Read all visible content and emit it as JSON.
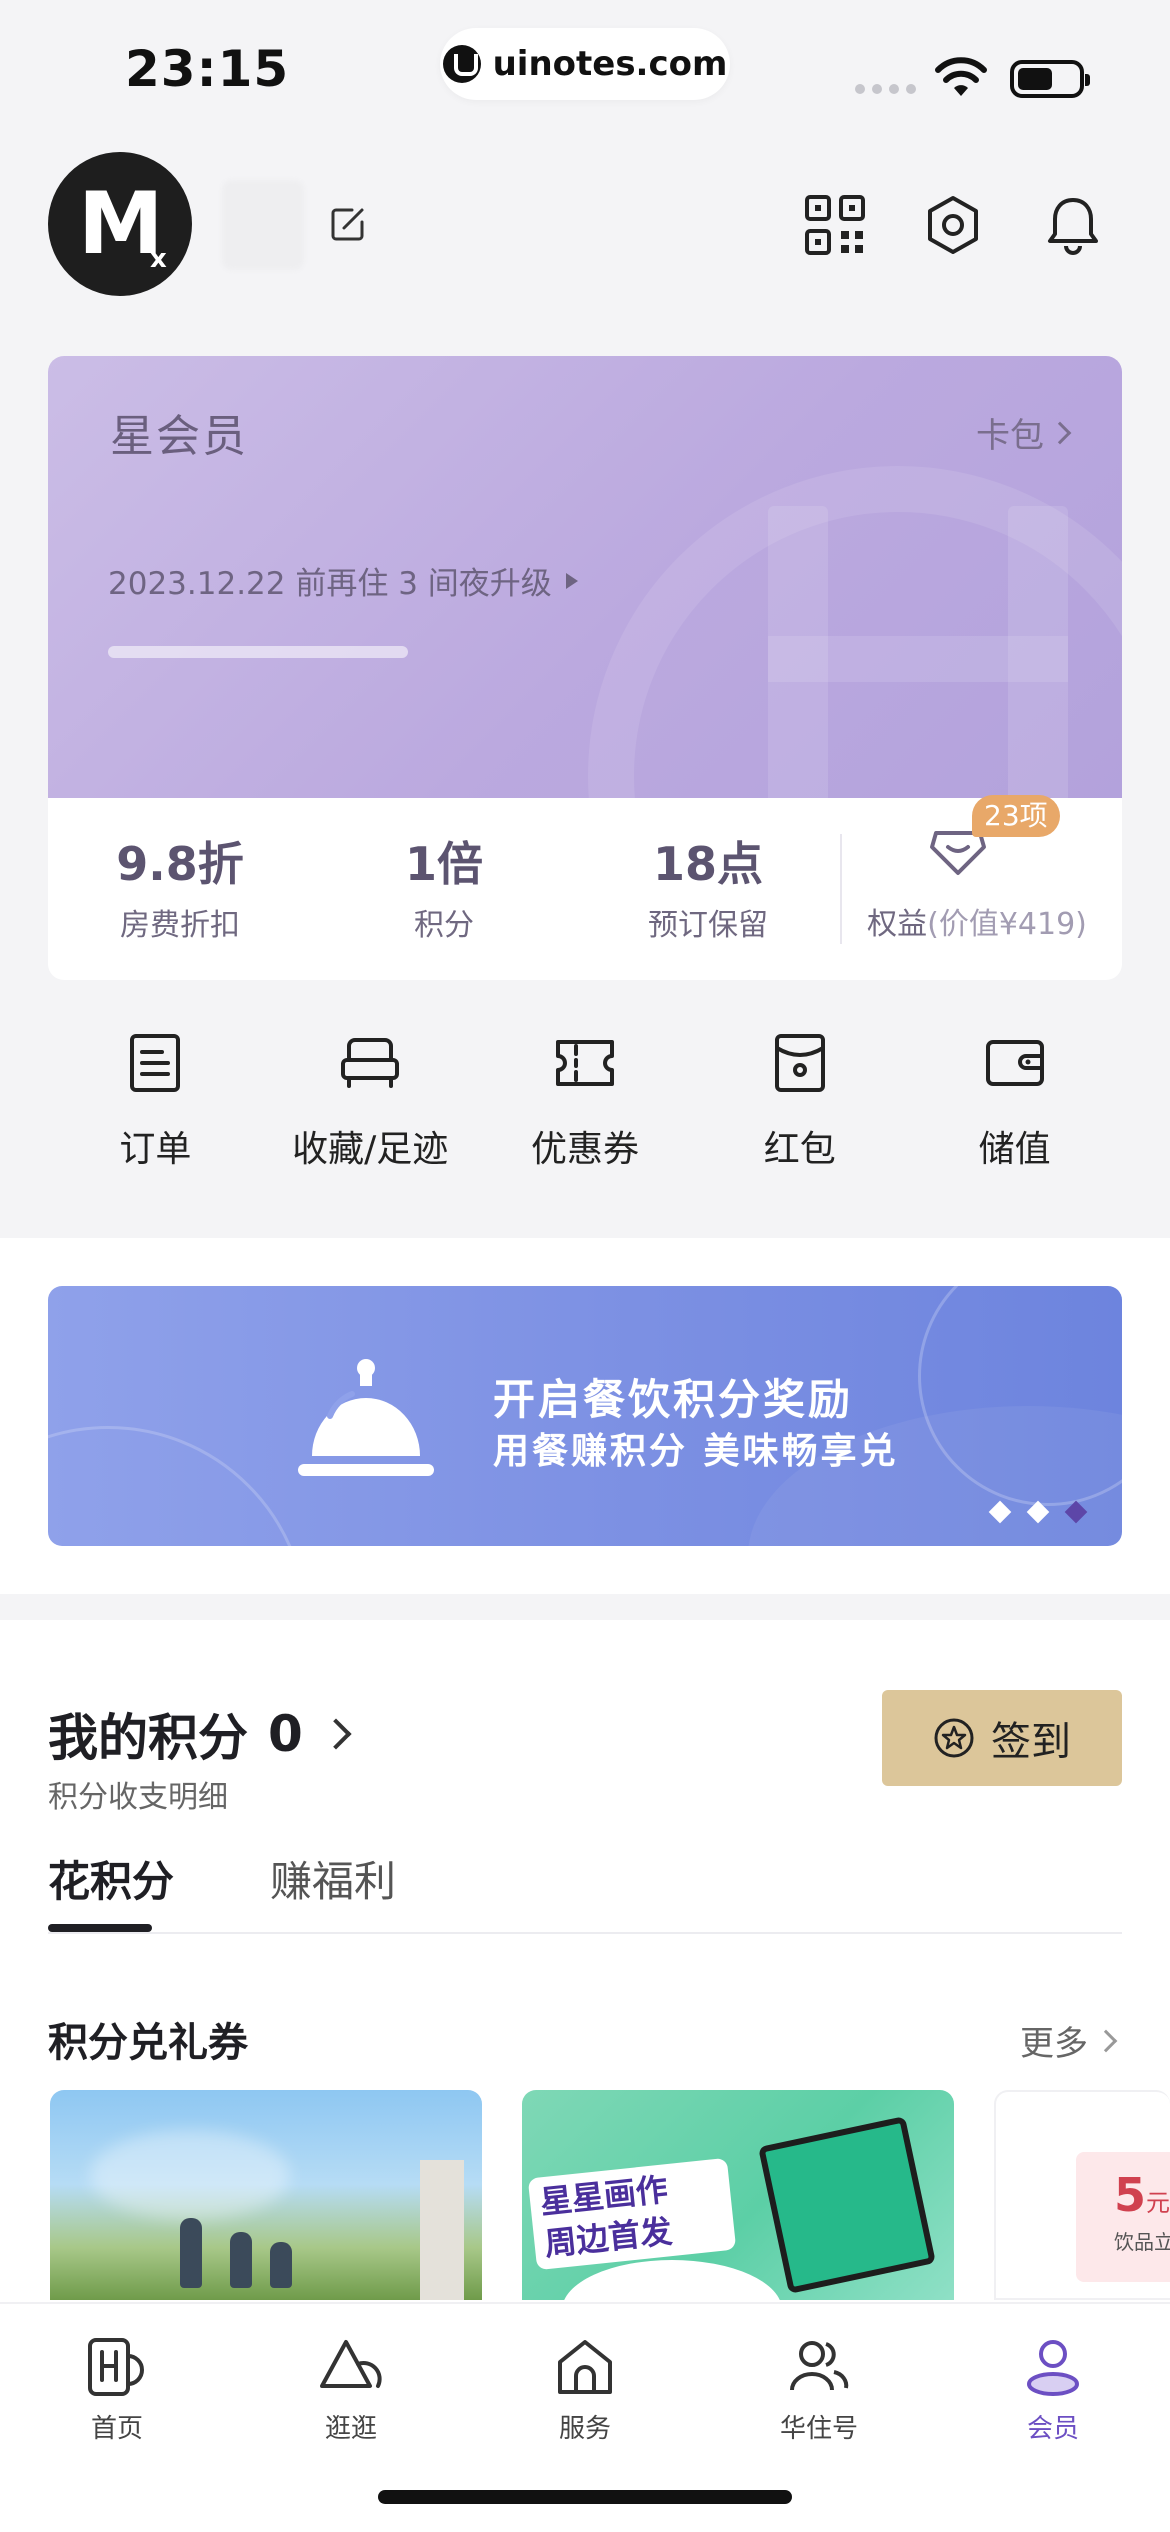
{
  "status_bar": {
    "time": "23:15",
    "site": "uinotes.com",
    "battery_level": 0.58
  },
  "header": {
    "avatar_letter": "M",
    "avatar_sub": "x",
    "icons": [
      "qr-code-icon",
      "settings-icon",
      "bell-icon"
    ]
  },
  "member_card": {
    "level": "星会员",
    "wallet_label": "卡包",
    "upgrade_text": "2023.12.22 前再住 3 间夜升级",
    "upgrade_progress": 0.0,
    "stats": [
      {
        "value": "9.8折",
        "label": "房费折扣"
      },
      {
        "value": "1倍",
        "label": "积分"
      },
      {
        "value": "18点",
        "label": "预订保留"
      }
    ],
    "benefits": {
      "badge": "23项",
      "label": "权益",
      "value_note": "(价值¥419)"
    }
  },
  "quick_actions": [
    {
      "label": "订单",
      "icon": "order-icon"
    },
    {
      "label": "收藏/足迹",
      "icon": "bed-icon"
    },
    {
      "label": "优惠券",
      "icon": "coupon-icon"
    },
    {
      "label": "红包",
      "icon": "red-packet-icon"
    },
    {
      "label": "储值",
      "icon": "wallet-icon"
    }
  ],
  "banner": {
    "title": "开启餐饮积分奖励",
    "subtitle": "用餐赚积分 美味畅享兑",
    "active_dot": 3,
    "dot_count": 3
  },
  "points": {
    "title": "我的积分",
    "value": "0",
    "subtitle": "积分收支明细",
    "signin_label": "签到"
  },
  "tabs": [
    {
      "label": "花积分",
      "active": true
    },
    {
      "label": "赚福利",
      "active": false
    }
  ],
  "redeem": {
    "title": "积分兑礼券",
    "more_label": "更多",
    "cards": [
      {
        "type": "photo",
        "desc": ""
      },
      {
        "type": "promo",
        "text": "星星画作\n周边首发"
      },
      {
        "type": "coupon",
        "amount": "5",
        "unit": "元",
        "desc": "饮品立减"
      }
    ]
  },
  "tabbar": {
    "items": [
      {
        "label": "首页",
        "icon": "home-h-icon",
        "active": false
      },
      {
        "label": "逛逛",
        "icon": "explore-icon",
        "active": false
      },
      {
        "label": "服务",
        "icon": "service-icon",
        "active": false
      },
      {
        "label": "华住号",
        "icon": "community-icon",
        "active": false
      },
      {
        "label": "会员",
        "icon": "member-icon",
        "active": true
      }
    ]
  },
  "colors": {
    "card_gradient_start": "#cbbde6",
    "card_gradient_end": "#b3a2dc",
    "banner_blue": "#7c90e3",
    "signin_gold": "#dcc69a",
    "accent_purple": "#6c4fc3",
    "badge_orange": "#e8a869"
  }
}
